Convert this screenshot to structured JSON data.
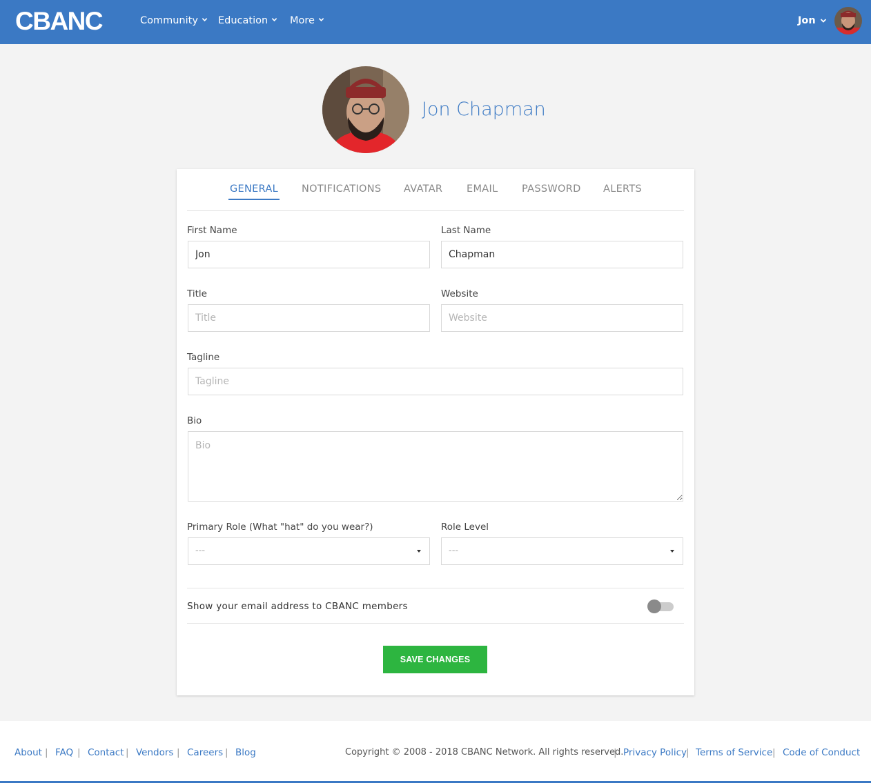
{
  "header": {
    "logo": "CBANC",
    "nav": [
      {
        "label": "Community"
      },
      {
        "label": "Education"
      },
      {
        "label": "More"
      }
    ],
    "user_name": "Jon"
  },
  "profile": {
    "full_name": "Jon Chapman"
  },
  "tabs": [
    {
      "label": "GENERAL",
      "active": true
    },
    {
      "label": "NOTIFICATIONS"
    },
    {
      "label": "AVATAR"
    },
    {
      "label": "EMAIL"
    },
    {
      "label": "PASSWORD"
    },
    {
      "label": "ALERTS"
    }
  ],
  "form": {
    "first_name": {
      "label": "First Name",
      "value": "Jon"
    },
    "last_name": {
      "label": "Last Name",
      "value": "Chapman"
    },
    "title": {
      "label": "Title",
      "placeholder": "Title"
    },
    "website": {
      "label": "Website",
      "placeholder": "Website"
    },
    "tagline": {
      "label": "Tagline",
      "placeholder": "Tagline"
    },
    "bio": {
      "label": "Bio",
      "placeholder": "Bio"
    },
    "primary_role": {
      "label": "Primary Role (What \"hat\" do you wear?)",
      "selected": "---"
    },
    "role_level": {
      "label": "Role Level",
      "selected": "---"
    },
    "show_email": {
      "label": "Show your email address to CBANC members",
      "enabled": false
    },
    "save_label": "SAVE CHANGES"
  },
  "footer": {
    "links": [
      "About",
      "FAQ",
      "Contact",
      "Vendors",
      "Careers",
      "Blog"
    ],
    "copyright": "Copyright © 2008 - 2018 CBANC Network. All rights reserved.",
    "legal_links": [
      "Privacy Policy",
      "Terms of Service",
      "Code of Conduct"
    ]
  },
  "colors": {
    "brand_blue": "#3b79c4",
    "save_green": "#2db540",
    "background": "#f3f3f3"
  }
}
